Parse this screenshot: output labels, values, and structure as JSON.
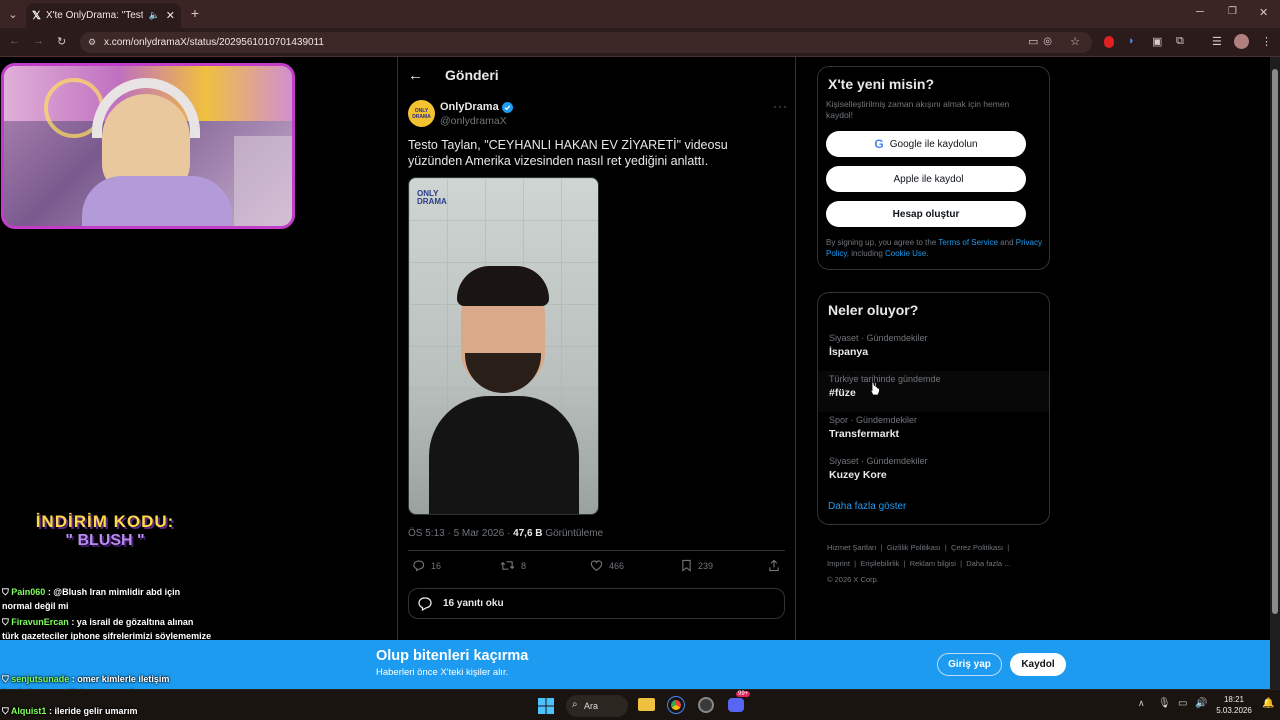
{
  "browser": {
    "tab_title": "X'te OnlyDrama: \"Testo Tayl",
    "url": "x.com/onlydramaX/status/2029561010701439011"
  },
  "header": {
    "title": "Gönderi"
  },
  "tweet": {
    "author_name": "OnlyDrama",
    "author_handle": "@onlydramaX",
    "avatar_text": "ONLY DRAMA",
    "text": "Testo Taylan, \"CEYHANLI HAKAN EV ZİYARETİ\" videosu yüzünden Amerika vizesinden nasıl ret yediğini anlattı.",
    "media_watermark": "ONLY DRAMA",
    "time": "ÖS 5:13 · 5 Mar 2026 ·",
    "views_count": "47,6 B",
    "views_label": "Görüntüleme",
    "replies": "16",
    "retweets": "8",
    "likes": "466",
    "bookmarks": "239",
    "read_replies": "16 yanıtı oku"
  },
  "signup": {
    "title": "X'te yeni misin?",
    "subtitle": "Kişiselleştirilmiş zaman akışını almak için hemen kaydol!",
    "google": "Google ile kaydolun",
    "apple": "Apple ile kaydol",
    "create": "Hesap oluştur",
    "legal_1": "By signing up, you agree to the ",
    "terms": "Terms of Service",
    "legal_2": " and ",
    "privacy": "Privacy Policy",
    "legal_3": ", including ",
    "cookie": "Cookie Use",
    "legal_4": "."
  },
  "trends": {
    "title": "Neler oluyor?",
    "items": [
      {
        "category": "Siyaset · Gündemdekiler",
        "name": "İspanya"
      },
      {
        "category": "Türkiye tarihinde gündemde",
        "name": "#füze"
      },
      {
        "category": "Spor · Gündemdekiler",
        "name": "Transfermarkt"
      },
      {
        "category": "Siyaset · Gündemdekiler",
        "name": "Kuzey Kore"
      }
    ],
    "more": "Daha fazla göster"
  },
  "footer": {
    "links": [
      "Hizmet Şartları",
      "Gizlilik Politikası",
      "Çerez Politikası",
      "Imprint",
      "Erişilebilirlik",
      "Reklam bilgisi",
      "Daha fazla ..."
    ],
    "copyright": "© 2026 X Corp."
  },
  "banner": {
    "title": "Olup bitenleri kaçırma",
    "subtitle": "Haberleri önce X'teki kişiler alır.",
    "login": "Giriş yap",
    "signup": "Kaydol"
  },
  "overlay": {
    "promo_line1": "İNDİRİM KODU:",
    "promo_line2": "\" BLUSH \"",
    "chat": [
      {
        "user": "Pain060",
        "msg": ": @Blush Iran mimlidir abd için normal değil mi"
      },
      {
        "user": "FiravunErcan",
        "msg": ": ya israil de gözaltına alınan türk gazeteciler iphone şifrelerimizi söylememize rağmen açıp incelemişler dedi. onlara kadar girip inceliyorlar"
      },
      {
        "user": "senjutsunade",
        "msg": ": omer kimlerle iletişim kurduğunu vs gösteren şey mi o"
      },
      {
        "user": "Alquist1",
        "msg": ": ileride gelir umarım"
      }
    ]
  },
  "taskbar": {
    "search": "Ara",
    "time": "18:21",
    "date": "5.03.2026",
    "discord_badge": "99+"
  },
  "colors": {
    "accent": "#1d9bf0",
    "verified": "#1d9bf0",
    "tab_bg": "#3a2424"
  }
}
